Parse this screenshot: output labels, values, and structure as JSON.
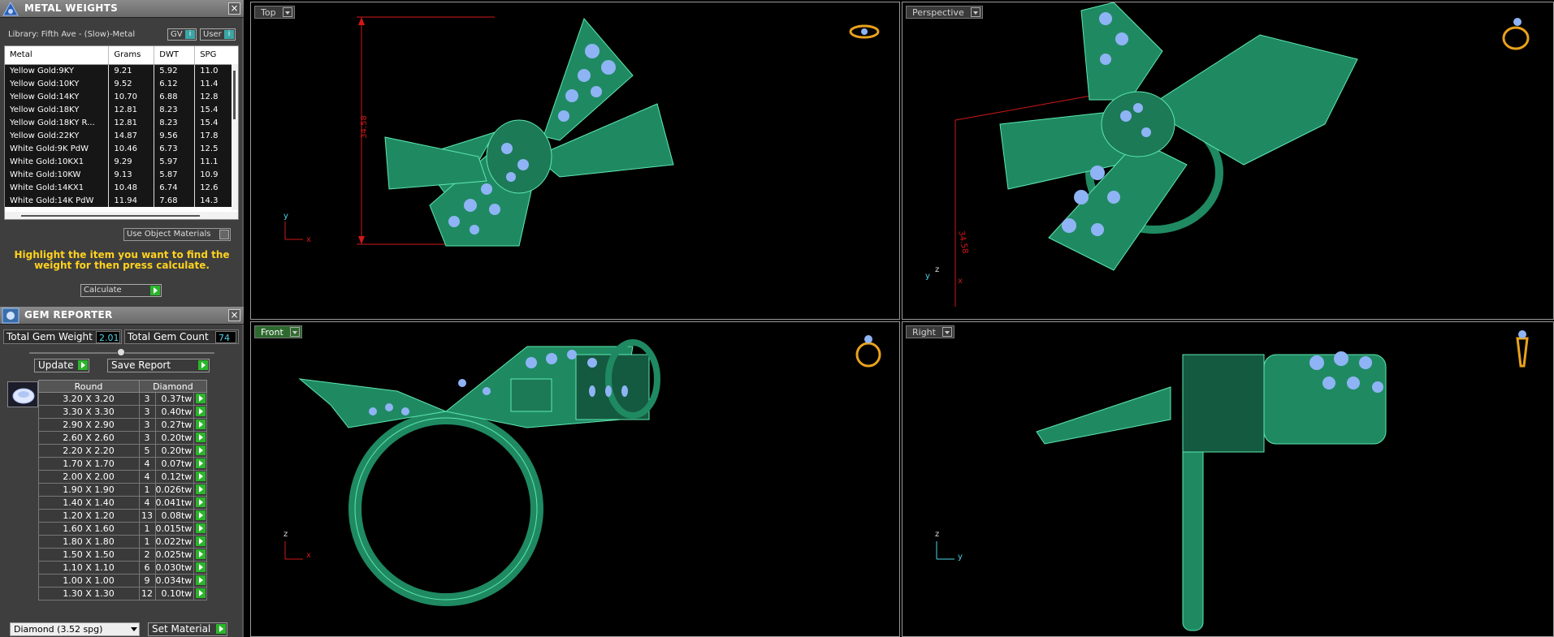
{
  "metal_weights": {
    "title": "METAL WEIGHTS",
    "library": "Library: Fifth Ave - (Slow)-Metal",
    "gv_label": "GV",
    "user_label": "User",
    "columns": [
      "Metal",
      "Grams",
      "DWT",
      "SPG"
    ],
    "rows": [
      {
        "metal": "Yellow Gold:9KY",
        "grams": "9.21",
        "dwt": "5.92",
        "spg": "11.0"
      },
      {
        "metal": "Yellow Gold:10KY",
        "grams": "9.52",
        "dwt": "6.12",
        "spg": "11.4"
      },
      {
        "metal": "Yellow Gold:14KY",
        "grams": "10.70",
        "dwt": "6.88",
        "spg": "12.8"
      },
      {
        "metal": "Yellow Gold:18KY",
        "grams": "12.81",
        "dwt": "8.23",
        "spg": "15.4"
      },
      {
        "metal": "Yellow Gold:18KY R...",
        "grams": "12.81",
        "dwt": "8.23",
        "spg": "15.4"
      },
      {
        "metal": "Yellow Gold:22KY",
        "grams": "14.87",
        "dwt": "9.56",
        "spg": "17.8"
      },
      {
        "metal": "White Gold:9K PdW",
        "grams": "10.46",
        "dwt": "6.73",
        "spg": "12.5"
      },
      {
        "metal": "White Gold:10KX1",
        "grams": "9.29",
        "dwt": "5.97",
        "spg": "11.1"
      },
      {
        "metal": "White Gold:10KW",
        "grams": "9.13",
        "dwt": "5.87",
        "spg": "10.9"
      },
      {
        "metal": "White Gold:14KX1",
        "grams": "10.48",
        "dwt": "6.74",
        "spg": "12.6"
      },
      {
        "metal": "White Gold:14K PdW",
        "grams": "11.94",
        "dwt": "7.68",
        "spg": "14.3"
      }
    ],
    "use_object_materials": "Use Object Materials",
    "hint": "Highlight the item you want to find the weight for then press calculate.",
    "calculate": "Calculate"
  },
  "gem_reporter": {
    "title": "GEM REPORTER",
    "total_weight_label": "Total Gem Weight",
    "total_weight": "2.01",
    "total_count_label": "Total Gem Count",
    "total_count": "74",
    "update": "Update",
    "save_report": "Save Report",
    "col_shape": "Round",
    "col_material": "Diamond",
    "gems": [
      {
        "size": "3.20 X 3.20",
        "count": "3",
        "weight": "0.37tw"
      },
      {
        "size": "3.30 X 3.30",
        "count": "3",
        "weight": "0.40tw"
      },
      {
        "size": "2.90 X 2.90",
        "count": "3",
        "weight": "0.27tw"
      },
      {
        "size": "2.60 X 2.60",
        "count": "3",
        "weight": "0.20tw"
      },
      {
        "size": "2.20 X 2.20",
        "count": "5",
        "weight": "0.20tw"
      },
      {
        "size": "1.70 X 1.70",
        "count": "4",
        "weight": "0.07tw"
      },
      {
        "size": "2.00 X 2.00",
        "count": "4",
        "weight": "0.12tw"
      },
      {
        "size": "1.90 X 1.90",
        "count": "1",
        "weight": "0.026tw"
      },
      {
        "size": "1.40 X 1.40",
        "count": "4",
        "weight": "0.041tw"
      },
      {
        "size": "1.20 X 1.20",
        "count": "13",
        "weight": "0.08tw"
      },
      {
        "size": "1.60 X 1.60",
        "count": "1",
        "weight": "0.015tw"
      },
      {
        "size": "1.80 X 1.80",
        "count": "1",
        "weight": "0.022tw"
      },
      {
        "size": "1.50 X 1.50",
        "count": "2",
        "weight": "0.025tw"
      },
      {
        "size": "1.10 X 1.10",
        "count": "6",
        "weight": "0.030tw"
      },
      {
        "size": "1.00 X 1.00",
        "count": "9",
        "weight": "0.034tw"
      },
      {
        "size": "1.30 X 1.30",
        "count": "12",
        "weight": "0.10tw"
      }
    ],
    "material_select": "Diamond    (3.52 spg)",
    "set_material": "Set Material"
  },
  "viewports": {
    "top": {
      "label": "Top",
      "dimension": "34.58",
      "axis_v": "y",
      "axis_h": "x"
    },
    "perspective": {
      "label": "Perspective",
      "dimension": "34.58",
      "axis_a": "y",
      "axis_b": "z",
      "axis_c": "x"
    },
    "front": {
      "label": "Front",
      "axis_v": "z",
      "axis_h": "x"
    },
    "right": {
      "label": "Right",
      "axis_v": "z",
      "axis_h": "y"
    }
  },
  "colors": {
    "metal": "#1f8a62",
    "metal_edge": "#5de8b0",
    "gem": "#8fb4f5",
    "dimension": "#d01818",
    "hint": "#ffd21e",
    "icon_gold": "#e8a21c"
  }
}
